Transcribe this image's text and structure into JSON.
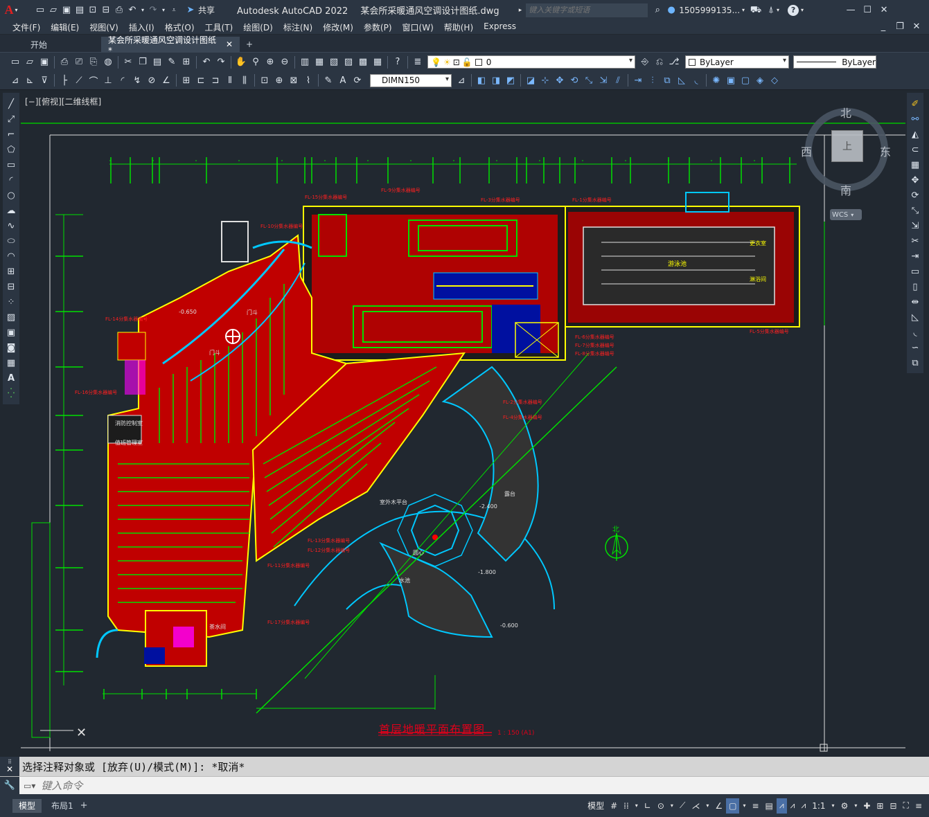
{
  "app": {
    "title": "Autodesk AutoCAD 2022",
    "document_title": "某会所采暖通风空调设计图纸.dwg",
    "share_label": "共享",
    "search_placeholder": "键入关键字或短语",
    "user": "1505999135...",
    "logo_letter": "A"
  },
  "menu": [
    "文件(F)",
    "编辑(E)",
    "视图(V)",
    "插入(I)",
    "格式(O)",
    "工具(T)",
    "绘图(D)",
    "标注(N)",
    "修改(M)",
    "参数(P)",
    "窗口(W)",
    "帮助(H)",
    "Express"
  ],
  "tabs": {
    "start": "开始",
    "active": "某会所采暖通风空调设计图纸*",
    "add": "+"
  },
  "toolbar": {
    "layer_value": "0",
    "color_value": "ByLayer",
    "linetype_value": "ByLayer",
    "dimstyle_value": "DIMN150"
  },
  "viewport": {
    "label": "[−][俯视][二维线框]",
    "viewcube": {
      "north": "北",
      "south": "南",
      "east": "东",
      "west": "西",
      "top": "上",
      "wcs": "WCS"
    }
  },
  "drawing": {
    "title": "首层地暖平面布置图",
    "scale": "1 : 150 (A1)",
    "north_label": "北",
    "room_labels": [
      "游泳池",
      "更衣室",
      "淋浴间",
      "露台",
      "水池",
      "室外木平台",
      "门斗",
      "门斗",
      "消防控制室",
      "值班管理室",
      "茶水间",
      "圆心"
    ],
    "levels": [
      "-0.650",
      "-2.400",
      "-1.800",
      "-0.600"
    ],
    "manifold_labels": [
      "FL-15分集水器编号",
      "FL-9分集水器编号",
      "FL-3分集水器编号",
      "FL-1分集水器编号",
      "FL-10分集水器编号",
      "FL-14分集水器编号",
      "FL-6分集水器编号",
      "FL-7分集水器编号",
      "FL-8分集水器编号",
      "FL-5分集水器编号",
      "FL-2分集水器编号",
      "FL-4分集水器编号",
      "FL-16分集水器编号",
      "FL-13分集水器编号",
      "FL-12分集水器编号",
      "FL-11分集水器编号",
      "FL-17分集水器编号"
    ]
  },
  "command": {
    "history": "选择注释对象或 [放弃(U)/模式(M)]: *取消*",
    "placeholder": "键入命令"
  },
  "layout_tabs": [
    "模型",
    "布局1"
  ],
  "status": {
    "model_label": "模型",
    "scale": "1:1"
  },
  "colors": {
    "background": "#212830",
    "chrome": "#2b3542",
    "pipe_red": "#ff0000",
    "pipe_green": "#00e000",
    "wall_yellow": "#ffff00",
    "cyan": "#00c8ff",
    "title_red": "#e0001a"
  }
}
